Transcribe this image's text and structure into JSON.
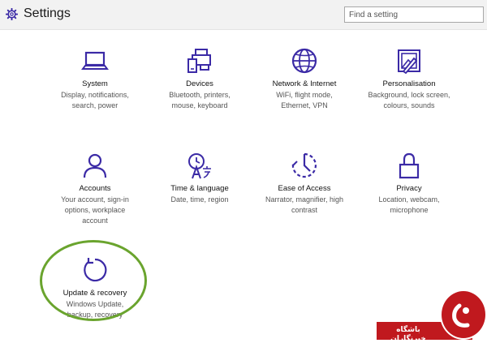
{
  "app": {
    "title": "Settings",
    "icon": "gear-icon"
  },
  "search": {
    "placeholder": "Find a setting"
  },
  "tiles": [
    {
      "label": "System",
      "desc": "Display, notifications, search, power",
      "icon": "laptop-icon"
    },
    {
      "label": "Devices",
      "desc": "Bluetooth, printers, mouse, keyboard",
      "icon": "devices-icon"
    },
    {
      "label": "Network & Internet",
      "desc": "WiFi, flight mode, Ethernet, VPN",
      "icon": "globe-icon"
    },
    {
      "label": "Personalisation",
      "desc": "Background, lock screen, colours, sounds",
      "icon": "personalisation-icon"
    },
    {
      "label": "Accounts",
      "desc": "Your account, sign-in options, workplace account",
      "icon": "person-icon"
    },
    {
      "label": "Time & language",
      "desc": "Date, time, region",
      "icon": "time-language-icon"
    },
    {
      "label": "Ease of Access",
      "desc": "Narrator, magnifier, high contrast",
      "icon": "ease-of-access-icon"
    },
    {
      "label": "Privacy",
      "desc": "Location, webcam, microphone",
      "icon": "lock-icon"
    },
    {
      "label": "Update & recovery",
      "desc": "Windows Update, backup, recovery",
      "icon": "update-icon"
    }
  ],
  "colors": {
    "accent": "#3b2aa6",
    "highlight": "#6aa42e",
    "brand": "#c0191e"
  },
  "watermark": {
    "text": "باشگاه خبرنگاران"
  }
}
